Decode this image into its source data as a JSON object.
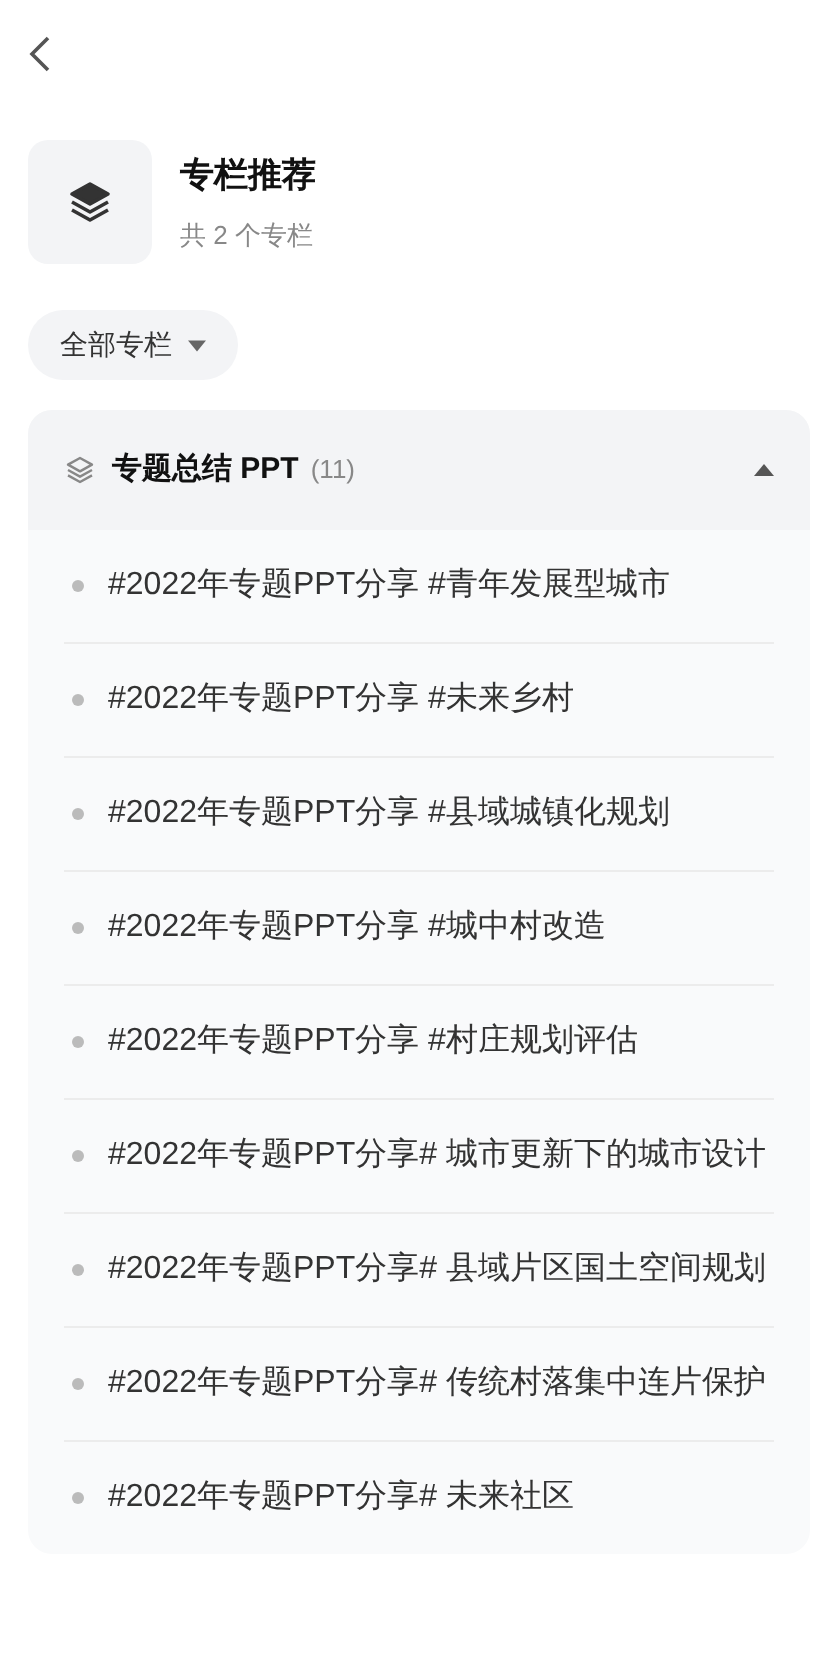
{
  "header": {
    "title": "专栏推荐",
    "subtitle": "共 2 个专栏"
  },
  "filter": {
    "label": "全部专栏"
  },
  "section": {
    "title": "专题总结 PPT",
    "count": "(11)",
    "expanded": true,
    "items": [
      {
        "text": "#2022年专题PPT分享 #青年发展型城市"
      },
      {
        "text": "#2022年专题PPT分享 #未来乡村"
      },
      {
        "text": "#2022年专题PPT分享 #县域城镇化规划"
      },
      {
        "text": "#2022年专题PPT分享 #城中村改造"
      },
      {
        "text": "#2022年专题PPT分享 #村庄规划评估"
      },
      {
        "text": "#2022年专题PPT分享# 城市更新下的城市设计"
      },
      {
        "text": "#2022年专题PPT分享# 县域片区国土空间规划"
      },
      {
        "text": "#2022年专题PPT分享# 传统村落集中连片保护"
      },
      {
        "text": "#2022年专题PPT分享# 未来社区"
      }
    ]
  }
}
